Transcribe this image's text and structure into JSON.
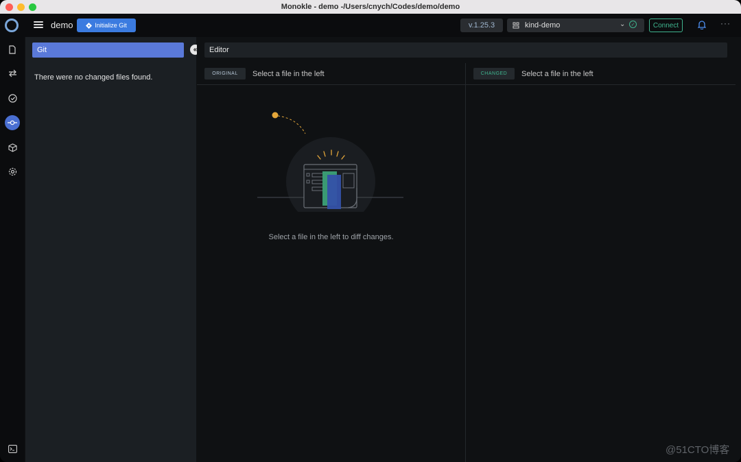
{
  "window": {
    "title": "Monokle - demo -/Users/cnych/Codes/demo/demo"
  },
  "header": {
    "project_name": "demo",
    "init_git_label": "Initialize Git",
    "version": "v.1.25.3",
    "cluster_context": "kind-demo",
    "connect_label": "Connect"
  },
  "sidebar": {
    "items": [
      {
        "icon": "file-icon"
      },
      {
        "icon": "compare-icon"
      },
      {
        "icon": "validation-icon"
      },
      {
        "icon": "git-commit-icon",
        "active": true
      },
      {
        "icon": "cube-icon"
      },
      {
        "icon": "settings-icon"
      }
    ],
    "bottom_icon": "terminal-icon"
  },
  "git_panel": {
    "tab_label": "Git",
    "empty_message": "There were no changed files found."
  },
  "editor": {
    "title": "Editor",
    "original_badge": "ORIGINAL",
    "original_text": "Select a file in the left",
    "changed_badge": "CHANGED",
    "changed_text": "Select a file in the left",
    "empty_message": "Select a file in the left to diff changes."
  },
  "watermark": "@51CTO博客",
  "colors": {
    "accent": "#3b7be0",
    "git_tab": "#5a79d9",
    "connect": "#3fb58f",
    "original_badge_text": "#b8c8d8",
    "changed_badge_text": "#3fb58f"
  }
}
